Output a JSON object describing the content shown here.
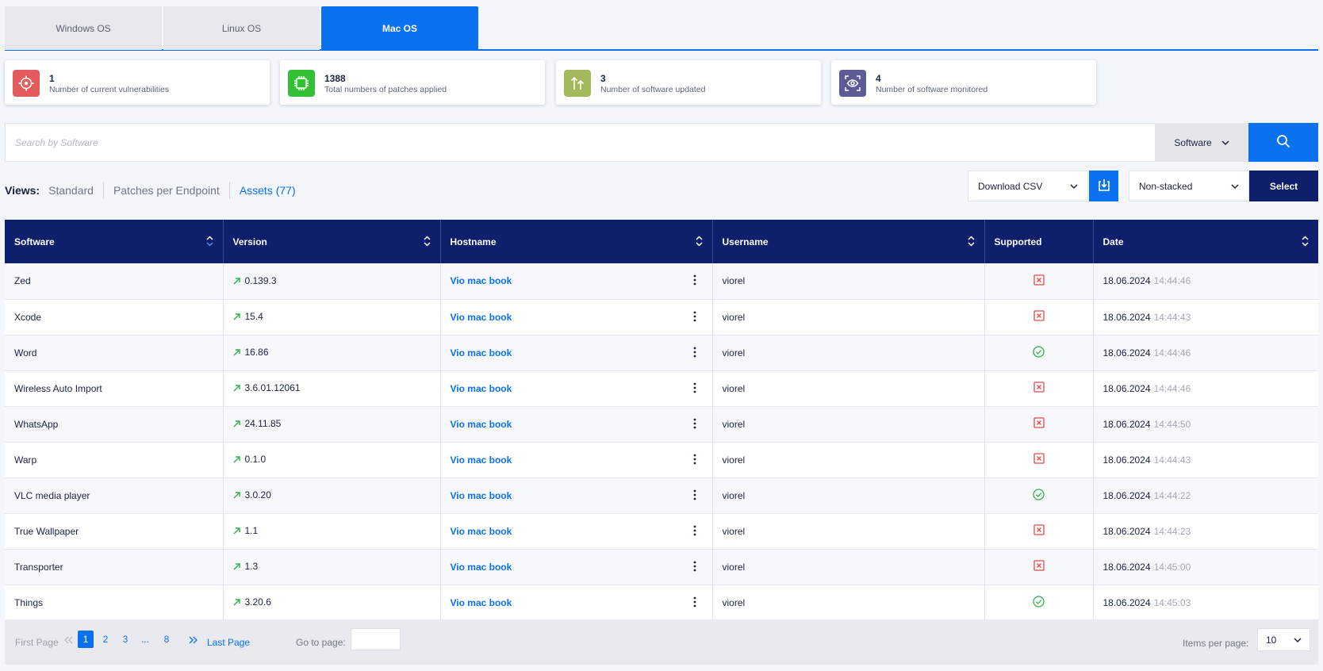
{
  "os_tabs": [
    {
      "label": "Windows OS"
    },
    {
      "label": "Linux OS"
    },
    {
      "label": "Mac OS",
      "active": true
    }
  ],
  "stats": [
    {
      "value": "1",
      "label": "Number of current vulnerabilities",
      "icon": "crosshair-icon",
      "color": "#e45b5b"
    },
    {
      "value": "1388",
      "label": "Total numbers of patches applied",
      "icon": "chip-icon",
      "color": "#34c035"
    },
    {
      "value": "3",
      "label": "Number of software updated",
      "icon": "upload-arrows-icon",
      "color": "#a3b85a"
    },
    {
      "value": "4",
      "label": "Number of software monitored",
      "icon": "eye-scan-icon",
      "color": "#5c5b93"
    }
  ],
  "search": {
    "placeholder": "Search by Software",
    "filter": "Software"
  },
  "views": {
    "label": "Views:",
    "items": [
      "Standard",
      "Patches per Endpoint",
      "Assets (77)"
    ],
    "active": "Assets (77)"
  },
  "actions": {
    "csv_label": "Download CSV",
    "stack_label": "Non-stacked",
    "select_label": "Select"
  },
  "table": {
    "columns": [
      "Software",
      "Version",
      "Hostname",
      "Username",
      "Supported",
      "Date"
    ],
    "rows": [
      {
        "software": "Zed",
        "version": "0.139.3",
        "hostname": "Vio mac book",
        "username": "viorel",
        "supported": false,
        "date": "18.06.2024",
        "time": "14:44:46"
      },
      {
        "software": "Xcode",
        "version": "15.4",
        "hostname": "Vio mac book",
        "username": "viorel",
        "supported": false,
        "date": "18.06.2024",
        "time": "14:44:43"
      },
      {
        "software": "Word",
        "version": "16.86",
        "hostname": "Vio mac book",
        "username": "viorel",
        "supported": true,
        "date": "18.06.2024",
        "time": "14:44:46"
      },
      {
        "software": "Wireless Auto Import",
        "version": "3.6.01.12061",
        "hostname": "Vio mac book",
        "username": "viorel",
        "supported": false,
        "date": "18.06.2024",
        "time": "14:44:46"
      },
      {
        "software": "WhatsApp",
        "version": "24.11.85",
        "hostname": "Vio mac book",
        "username": "viorel",
        "supported": false,
        "date": "18.06.2024",
        "time": "14:44:50"
      },
      {
        "software": "Warp",
        "version": "0.1.0",
        "hostname": "Vio mac book",
        "username": "viorel",
        "supported": false,
        "date": "18.06.2024",
        "time": "14:44:43"
      },
      {
        "software": "VLC media player",
        "version": "3.0.20",
        "hostname": "Vio mac book",
        "username": "viorel",
        "supported": true,
        "date": "18.06.2024",
        "time": "14:44:22"
      },
      {
        "software": "True Wallpaper",
        "version": "1.1",
        "hostname": "Vio mac book",
        "username": "viorel",
        "supported": false,
        "date": "18.06.2024",
        "time": "14:44:23"
      },
      {
        "software": "Transporter",
        "version": "1.3",
        "hostname": "Vio mac book",
        "username": "viorel",
        "supported": false,
        "date": "18.06.2024",
        "time": "14:45:00"
      },
      {
        "software": "Things",
        "version": "3.20.6",
        "hostname": "Vio mac book",
        "username": "viorel",
        "supported": true,
        "date": "18.06.2024",
        "time": "14:45:03"
      }
    ]
  },
  "pagination": {
    "first_label": "First Page",
    "pages": [
      "1",
      "2",
      "3",
      "...",
      "8"
    ],
    "current": "1",
    "last_label": "Last Page",
    "goto_label": "Go to page:",
    "items_per_page_label": "Items per page:",
    "items_per_page": "10"
  },
  "colors": {
    "accent": "#0a72f0",
    "header": "#0e1f6b",
    "unsupported": "#e14b4b",
    "supported": "#2fb24a"
  }
}
